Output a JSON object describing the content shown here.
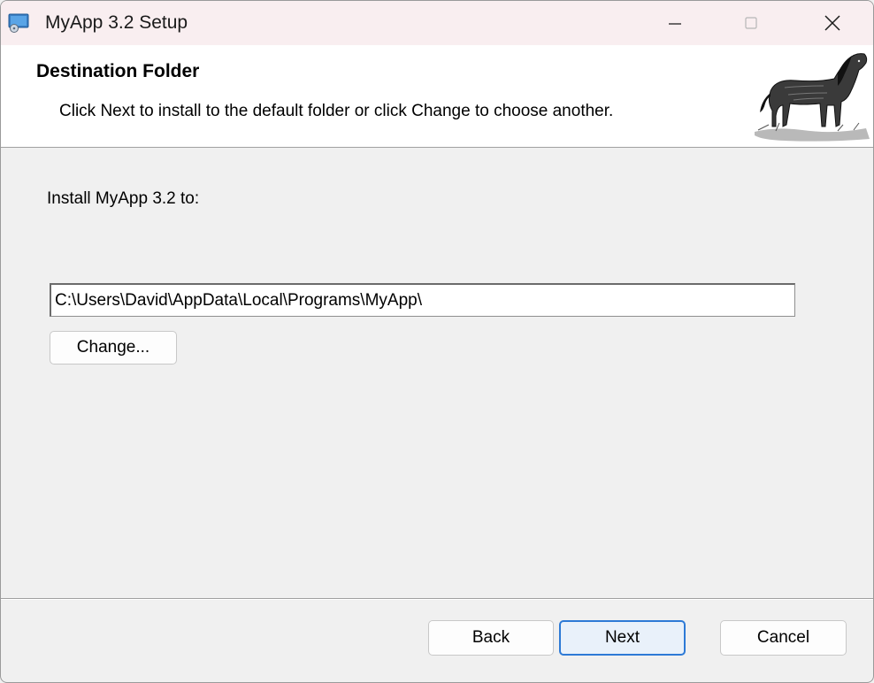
{
  "window": {
    "title": "MyApp 3.2 Setup",
    "controls": {
      "minimize": "minimize-icon",
      "maximize": "maximize-icon",
      "close": "close-icon"
    }
  },
  "banner": {
    "title": "Destination Folder",
    "subtitle": "Click Next to install to the default folder or click Change to choose another.",
    "image": "horse-illustration"
  },
  "body": {
    "install_label": "Install MyApp 3.2 to:",
    "path_value": "C:\\Users\\David\\AppData\\Local\\Programs\\MyApp\\",
    "change_label": "Change..."
  },
  "footer": {
    "back_label": "Back",
    "next_label": "Next",
    "cancel_label": "Cancel"
  },
  "colors": {
    "titlebar_bg": "#f9eef0",
    "accent": "#2d7ad6",
    "dialog_bg": "#f0f0f0"
  }
}
